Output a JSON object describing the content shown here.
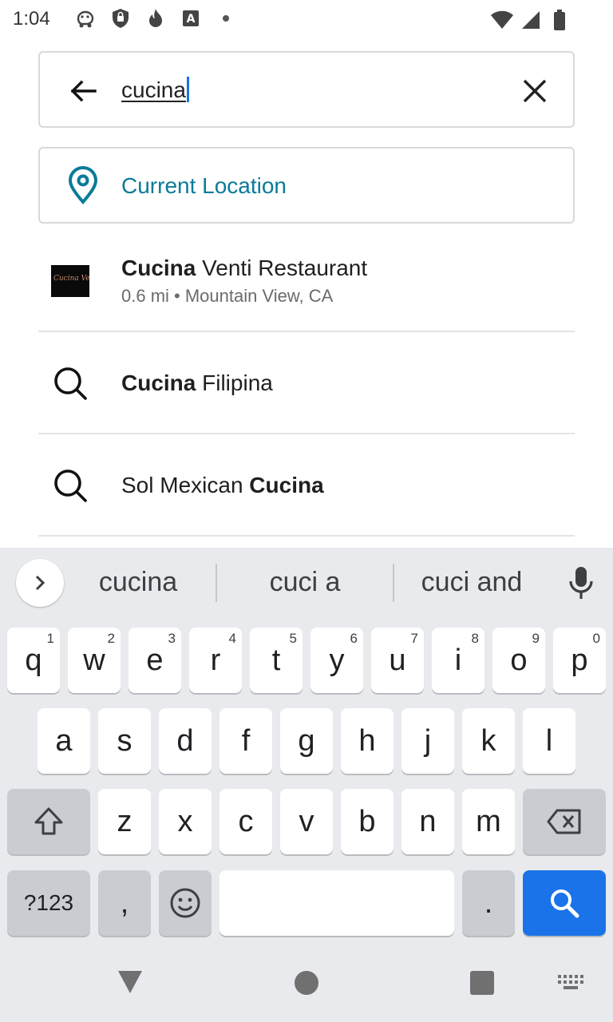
{
  "status": {
    "time": "1:04"
  },
  "search": {
    "query": "cucina",
    "back_icon": "arrow-left-icon",
    "clear_icon": "close-icon"
  },
  "current_location": {
    "label": "Current Location",
    "icon": "location-pin-icon",
    "color": "#0a7b99"
  },
  "results": [
    {
      "type": "restaurant",
      "bold": "Cucina",
      "rest": " Venti Restaurant",
      "subtitle": "0.6 mi • Mountain View, CA",
      "thumb_text": "Cucina Venti"
    },
    {
      "type": "search",
      "bold": "Cucina",
      "rest": " Filipina"
    },
    {
      "type": "search",
      "prefix": "Sol Mexican ",
      "bold": "Cucina"
    }
  ],
  "keyboard": {
    "suggestions": [
      "cucina",
      "cuci a",
      "cuci and"
    ],
    "row1": [
      "q",
      "w",
      "e",
      "r",
      "t",
      "y",
      "u",
      "i",
      "o",
      "p"
    ],
    "row1_hints": [
      "1",
      "2",
      "3",
      "4",
      "5",
      "6",
      "7",
      "8",
      "9",
      "0"
    ],
    "row2": [
      "a",
      "s",
      "d",
      "f",
      "g",
      "h",
      "j",
      "k",
      "l"
    ],
    "row3": [
      "z",
      "x",
      "c",
      "v",
      "b",
      "n",
      "m"
    ],
    "sym_label": "?123",
    "comma": ",",
    "period": ".",
    "accent": "#1a73e8"
  }
}
